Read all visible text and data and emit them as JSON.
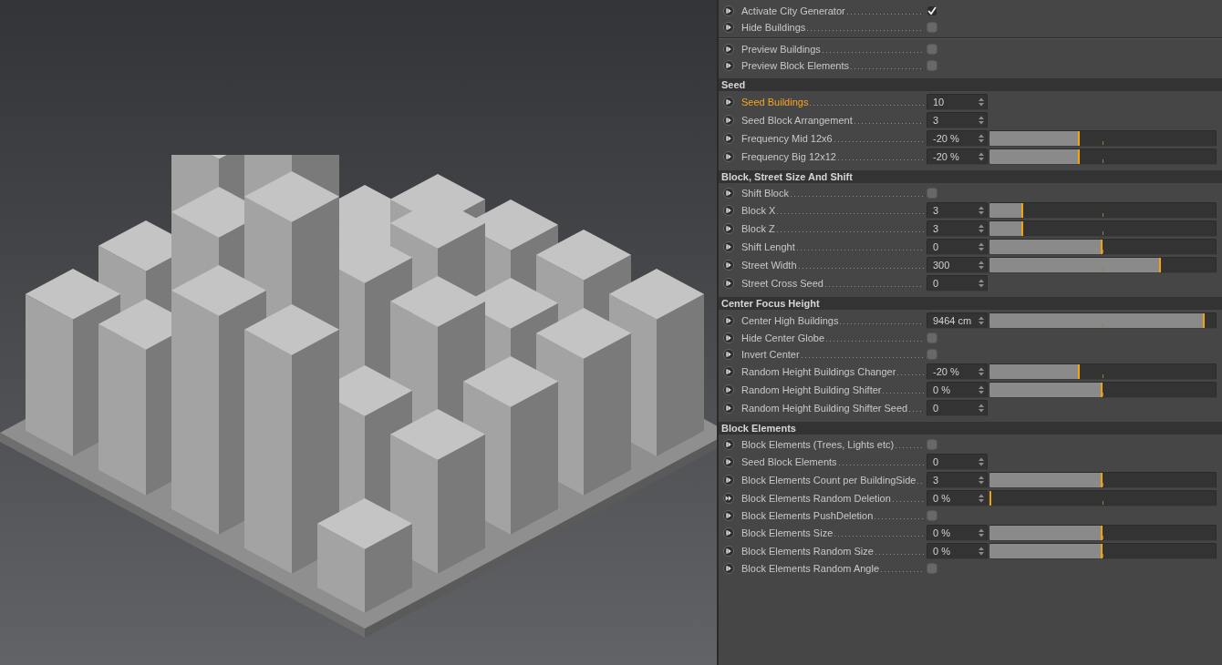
{
  "sections": [
    {
      "params": [
        {
          "label": "Activate City Generator",
          "kind": "checkbox",
          "checked": true,
          "selected": false,
          "animated": false
        },
        {
          "label": "Hide Buildings",
          "kind": "checkbox",
          "checked": false,
          "selected": false,
          "animated": false
        }
      ]
    },
    {
      "params": [
        {
          "label": "Preview Buildings",
          "kind": "checkbox",
          "checked": false,
          "selected": false,
          "animated": false
        },
        {
          "label": "Preview Block Elements",
          "kind": "checkbox",
          "checked": false,
          "selected": false,
          "animated": false
        }
      ]
    },
    {
      "title": "Seed",
      "params": [
        {
          "label": "Seed Buildings",
          "kind": "number",
          "value": "10",
          "selected": true,
          "animated": false
        },
        {
          "label": "Seed Block Arrangement",
          "kind": "number",
          "value": "3",
          "selected": false,
          "animated": false
        },
        {
          "label": "Frequency Mid 12x6",
          "kind": "slider",
          "value": "-20 %",
          "level": 0.4,
          "selected": false,
          "animated": false
        },
        {
          "label": "Frequency Big 12x12",
          "kind": "slider",
          "value": "-20 %",
          "level": 0.4,
          "selected": false,
          "animated": false
        }
      ]
    },
    {
      "title": "Block, Street Size And Shift",
      "params": [
        {
          "label": "Shift Block",
          "kind": "checkbox",
          "checked": false,
          "selected": false,
          "animated": false
        },
        {
          "label": "Block X",
          "kind": "slider",
          "value": "3",
          "level": 0.15,
          "selected": false,
          "animated": false
        },
        {
          "label": "Block Z",
          "kind": "slider",
          "value": "3",
          "level": 0.15,
          "selected": false,
          "animated": false
        },
        {
          "label": "Shift Lenght",
          "kind": "slider",
          "value": "0",
          "level": 0.5,
          "selected": false,
          "animated": false
        },
        {
          "label": "Street Width",
          "kind": "slider",
          "value": "300",
          "level": 0.76,
          "selected": false,
          "animated": false
        },
        {
          "label": "Street Cross Seed",
          "kind": "number",
          "value": "0",
          "selected": false,
          "animated": false
        }
      ]
    },
    {
      "title": "Center Focus Height",
      "params": [
        {
          "label": "Center High Buildings",
          "kind": "slider",
          "value": "9464 cm",
          "level": 0.95,
          "selected": false,
          "animated": false
        },
        {
          "label": "Hide Center Globe",
          "kind": "checkbox",
          "checked": false,
          "selected": false,
          "animated": false
        },
        {
          "label": "Invert Center",
          "kind": "checkbox",
          "checked": false,
          "selected": false,
          "animated": false
        },
        {
          "label": "Random Height Buildings Changer",
          "kind": "slider",
          "value": "-20 %",
          "level": 0.4,
          "selected": false,
          "animated": false
        },
        {
          "label": "Random Height Building Shifter",
          "kind": "slider",
          "value": "0 %",
          "level": 0.5,
          "selected": false,
          "animated": false
        },
        {
          "label": "Random Height Building Shifter Seed",
          "kind": "number",
          "value": "0",
          "selected": false,
          "animated": false
        }
      ]
    },
    {
      "title": "Block Elements",
      "params": [
        {
          "label": "Block Elements (Trees, Lights etc)",
          "kind": "checkbox",
          "checked": false,
          "selected": false,
          "animated": false
        },
        {
          "label": "Seed Block Elements",
          "kind": "number",
          "value": "0",
          "selected": false,
          "animated": false
        },
        {
          "label": "Block Elements Count per BuildingSide",
          "kind": "slider",
          "value": "3",
          "level": 0.5,
          "selected": false,
          "animated": false
        },
        {
          "label": "Block Elements Random Deletion",
          "kind": "slider",
          "value": "0 %",
          "level": 0,
          "selected": false,
          "animated": true
        },
        {
          "label": "Block Elements PushDeletion",
          "kind": "checkbox",
          "checked": false,
          "selected": false,
          "animated": false
        },
        {
          "label": "Block Elements Size",
          "kind": "slider",
          "value": "0 %",
          "level": 0.5,
          "selected": false,
          "animated": false
        },
        {
          "label": "Block Elements Random Size",
          "kind": "slider",
          "value": "0 %",
          "level": 0.5,
          "selected": false,
          "animated": false
        },
        {
          "label": "Block Elements Random Angle",
          "kind": "checkbox",
          "checked": false,
          "selected": false,
          "animated": false
        }
      ]
    }
  ]
}
